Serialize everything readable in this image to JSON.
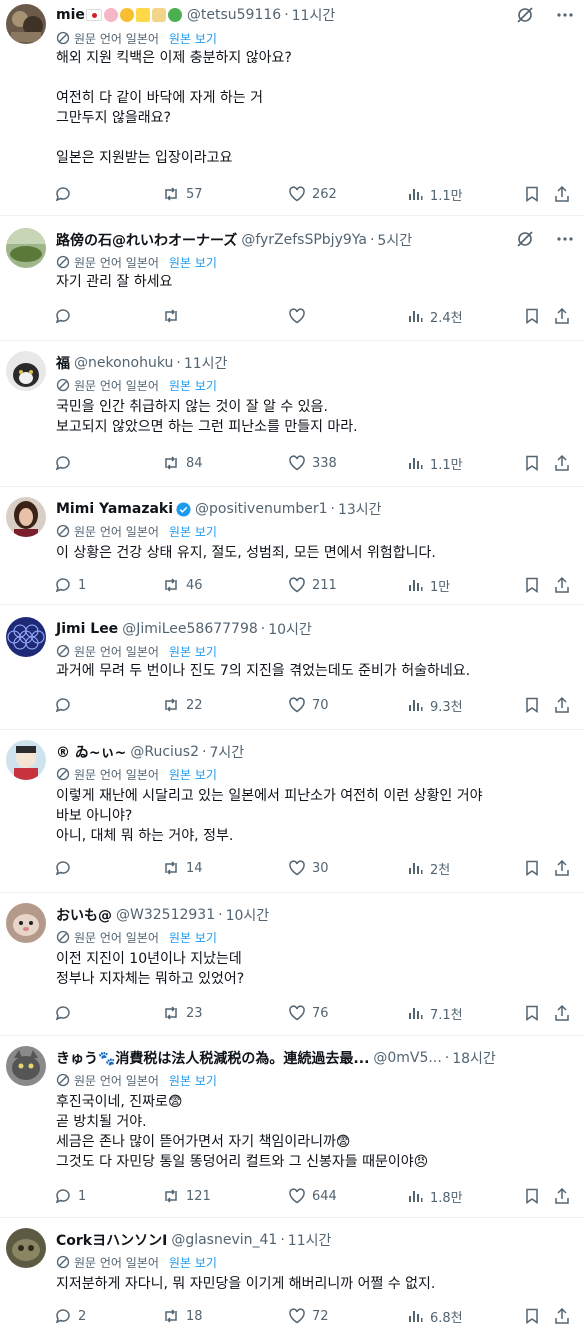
{
  "colors": {
    "accent": "#1d9bf0",
    "secondary_text": "#536471",
    "primary_text": "#0f1419",
    "divider": "#eff3f4"
  },
  "translate": {
    "label": "원문 언어 일본어",
    "show_original": "원본 보기"
  },
  "tweets": [
    {
      "name": "mie",
      "handle": "@tetsu59116",
      "sep": "·",
      "time": "11시간",
      "text": "해외 지원 킥백은 이제 충분하지 않아요?\n\n여전히 다 같이 바닥에 자게 하는 거\n그만두지 않을래요?\n\n일본은 지원받는 입장이라고요",
      "replies": "",
      "reposts": "57",
      "likes": "262",
      "views": "1.1만"
    },
    {
      "name": "路傍の石@れいわオーナーズ",
      "handle": "@fyrZefsSPbjy9Ya",
      "sep": "·",
      "time": "5시간",
      "text": "자기 관리 잘 하세요",
      "replies": "",
      "reposts": "",
      "likes": "",
      "views": "2.4천"
    },
    {
      "name": "福",
      "handle": "@nekonohuku",
      "sep": "·",
      "time": "11시간",
      "text": "국민을 인간 취급하지 않는 것이 잘 알 수 있음.\n보고되지 않았으면 하는 그런 피난소를 만들지 마라.",
      "replies": "",
      "reposts": "84",
      "likes": "338",
      "views": "1.1만"
    },
    {
      "name": "Mimi Yamazaki",
      "handle": "@positivenumber1",
      "sep": "·",
      "time": "13시간",
      "text": "이 상황은 건강 상태 유지, 절도, 성범죄, 모든 면에서 위험합니다.",
      "replies": "1",
      "reposts": "46",
      "likes": "211",
      "views": "1만"
    },
    {
      "name": "Jimi Lee",
      "handle": "@JimiLee58677798",
      "sep": "·",
      "time": "10시간",
      "text": "과거에 무려 두 번이나 진도 7의 지진을 겪었는데도 준비가 허술하네요.",
      "replies": "",
      "reposts": "22",
      "likes": "70",
      "views": "9.3천"
    },
    {
      "name": "® ゐ~ぃ~",
      "handle": "@Rucius2",
      "sep": "·",
      "time": "7시간",
      "text": "이렇게 재난에 시달리고 있는 일본에서 피난소가 여전히 이런 상황인 거야\n바보 아니야?\n아니, 대체 뭐 하는 거야, 정부.",
      "replies": "",
      "reposts": "14",
      "likes": "30",
      "views": "2천"
    },
    {
      "name": "おいも@",
      "handle": "@W32512931",
      "sep": "·",
      "time": "10시간",
      "text": "이전 지진이 10년이나 지났는데\n정부나 지자체는 뭐하고 있었어?",
      "replies": "",
      "reposts": "23",
      "likes": "76",
      "views": "7.1천"
    },
    {
      "name": "きゅう🐾消費税は法人税減税の為。連続過去最...",
      "handle": "@0mV5...",
      "sep": "·",
      "time": "18시간",
      "text": "후진국이네, 진짜로😨\n곧 방치될 거야.\n세금은 존나 많이 뜯어가면서 자기 책임이라니까😨\n그것도 다 자민당 통일 똥덩어리 컬트와 그 신봉자들 때문이야😠",
      "replies": "1",
      "reposts": "121",
      "likes": "644",
      "views": "1.8만"
    },
    {
      "name": "CorkヨハンソンI",
      "handle": "@glasnevin_41",
      "sep": "·",
      "time": "11시간",
      "text": "지저분하게 자다니, 뭐 자민당을 이기게 해버리니까 어쩔 수 없지.",
      "replies": "2",
      "reposts": "18",
      "likes": "72",
      "views": "6.8천"
    }
  ]
}
